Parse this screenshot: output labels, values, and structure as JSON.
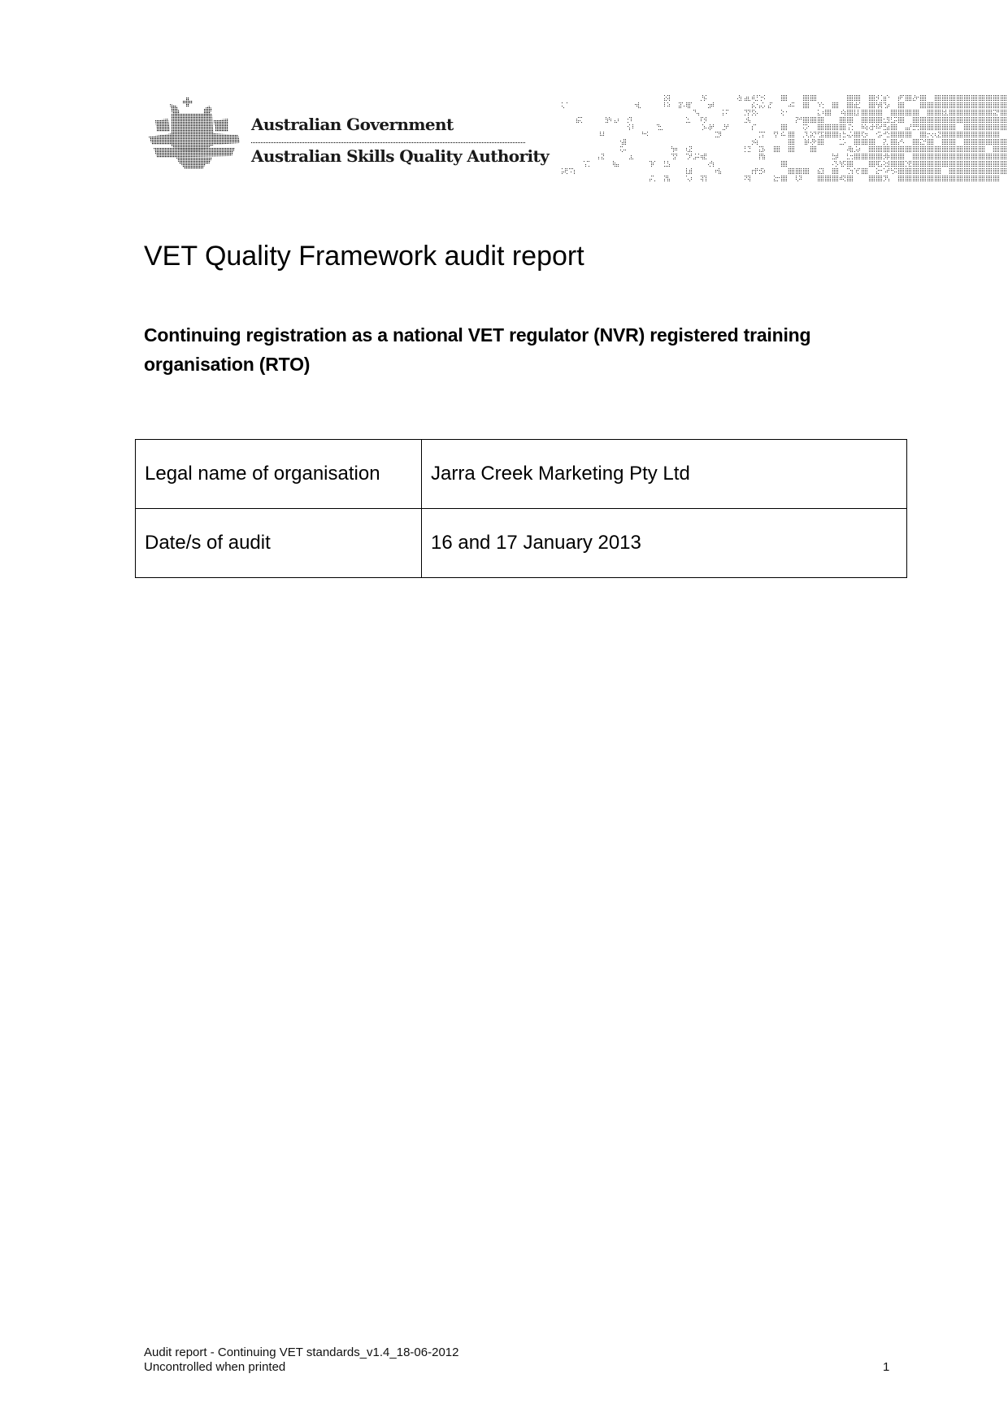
{
  "header": {
    "logo": {
      "crest_icon": "commonwealth-coat-of-arms",
      "line1": "Australian Government",
      "line2": "Australian Skills Quality Authority"
    },
    "decoration": "dot-matrix-pattern"
  },
  "document": {
    "title": "VET Quality Framework audit report",
    "subtitle": "Continuing registration as a national VET regulator (NVR) registered training organisation (RTO)"
  },
  "info_table": {
    "rows": [
      {
        "label": "Legal name of organisation",
        "value": "Jarra Creek Marketing Pty Ltd"
      },
      {
        "label": "Date/s of audit",
        "value": "16 and 17 January 2013"
      }
    ]
  },
  "footer": {
    "line1": "Audit report - Continuing VET standards_v1.4_18-06-2012",
    "line2": "Uncontrolled when printed",
    "page_number": "1"
  },
  "colors": {
    "text": "#000000",
    "background": "#ffffff"
  }
}
